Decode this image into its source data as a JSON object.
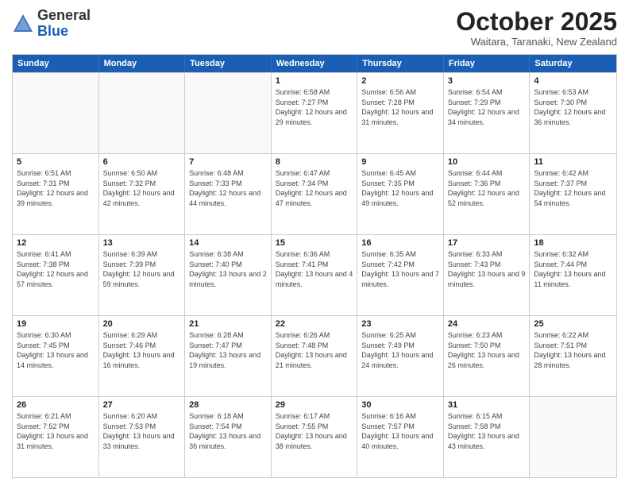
{
  "header": {
    "logo_general": "General",
    "logo_blue": "Blue",
    "month_title": "October 2025",
    "location": "Waitara, Taranaki, New Zealand"
  },
  "days_of_week": [
    "Sunday",
    "Monday",
    "Tuesday",
    "Wednesday",
    "Thursday",
    "Friday",
    "Saturday"
  ],
  "weeks": [
    [
      {
        "day": "",
        "info": ""
      },
      {
        "day": "",
        "info": ""
      },
      {
        "day": "",
        "info": ""
      },
      {
        "day": "1",
        "info": "Sunrise: 6:58 AM\nSunset: 7:27 PM\nDaylight: 12 hours and 29 minutes."
      },
      {
        "day": "2",
        "info": "Sunrise: 6:56 AM\nSunset: 7:28 PM\nDaylight: 12 hours and 31 minutes."
      },
      {
        "day": "3",
        "info": "Sunrise: 6:54 AM\nSunset: 7:29 PM\nDaylight: 12 hours and 34 minutes."
      },
      {
        "day": "4",
        "info": "Sunrise: 6:53 AM\nSunset: 7:30 PM\nDaylight: 12 hours and 36 minutes."
      }
    ],
    [
      {
        "day": "5",
        "info": "Sunrise: 6:51 AM\nSunset: 7:31 PM\nDaylight: 12 hours and 39 minutes."
      },
      {
        "day": "6",
        "info": "Sunrise: 6:50 AM\nSunset: 7:32 PM\nDaylight: 12 hours and 42 minutes."
      },
      {
        "day": "7",
        "info": "Sunrise: 6:48 AM\nSunset: 7:33 PM\nDaylight: 12 hours and 44 minutes."
      },
      {
        "day": "8",
        "info": "Sunrise: 6:47 AM\nSunset: 7:34 PM\nDaylight: 12 hours and 47 minutes."
      },
      {
        "day": "9",
        "info": "Sunrise: 6:45 AM\nSunset: 7:35 PM\nDaylight: 12 hours and 49 minutes."
      },
      {
        "day": "10",
        "info": "Sunrise: 6:44 AM\nSunset: 7:36 PM\nDaylight: 12 hours and 52 minutes."
      },
      {
        "day": "11",
        "info": "Sunrise: 6:42 AM\nSunset: 7:37 PM\nDaylight: 12 hours and 54 minutes."
      }
    ],
    [
      {
        "day": "12",
        "info": "Sunrise: 6:41 AM\nSunset: 7:38 PM\nDaylight: 12 hours and 57 minutes."
      },
      {
        "day": "13",
        "info": "Sunrise: 6:39 AM\nSunset: 7:39 PM\nDaylight: 12 hours and 59 minutes."
      },
      {
        "day": "14",
        "info": "Sunrise: 6:38 AM\nSunset: 7:40 PM\nDaylight: 13 hours and 2 minutes."
      },
      {
        "day": "15",
        "info": "Sunrise: 6:36 AM\nSunset: 7:41 PM\nDaylight: 13 hours and 4 minutes."
      },
      {
        "day": "16",
        "info": "Sunrise: 6:35 AM\nSunset: 7:42 PM\nDaylight: 13 hours and 7 minutes."
      },
      {
        "day": "17",
        "info": "Sunrise: 6:33 AM\nSunset: 7:43 PM\nDaylight: 13 hours and 9 minutes."
      },
      {
        "day": "18",
        "info": "Sunrise: 6:32 AM\nSunset: 7:44 PM\nDaylight: 13 hours and 11 minutes."
      }
    ],
    [
      {
        "day": "19",
        "info": "Sunrise: 6:30 AM\nSunset: 7:45 PM\nDaylight: 13 hours and 14 minutes."
      },
      {
        "day": "20",
        "info": "Sunrise: 6:29 AM\nSunset: 7:46 PM\nDaylight: 13 hours and 16 minutes."
      },
      {
        "day": "21",
        "info": "Sunrise: 6:28 AM\nSunset: 7:47 PM\nDaylight: 13 hours and 19 minutes."
      },
      {
        "day": "22",
        "info": "Sunrise: 6:26 AM\nSunset: 7:48 PM\nDaylight: 13 hours and 21 minutes."
      },
      {
        "day": "23",
        "info": "Sunrise: 6:25 AM\nSunset: 7:49 PM\nDaylight: 13 hours and 24 minutes."
      },
      {
        "day": "24",
        "info": "Sunrise: 6:23 AM\nSunset: 7:50 PM\nDaylight: 13 hours and 26 minutes."
      },
      {
        "day": "25",
        "info": "Sunrise: 6:22 AM\nSunset: 7:51 PM\nDaylight: 13 hours and 28 minutes."
      }
    ],
    [
      {
        "day": "26",
        "info": "Sunrise: 6:21 AM\nSunset: 7:52 PM\nDaylight: 13 hours and 31 minutes."
      },
      {
        "day": "27",
        "info": "Sunrise: 6:20 AM\nSunset: 7:53 PM\nDaylight: 13 hours and 33 minutes."
      },
      {
        "day": "28",
        "info": "Sunrise: 6:18 AM\nSunset: 7:54 PM\nDaylight: 13 hours and 36 minutes."
      },
      {
        "day": "29",
        "info": "Sunrise: 6:17 AM\nSunset: 7:55 PM\nDaylight: 13 hours and 38 minutes."
      },
      {
        "day": "30",
        "info": "Sunrise: 6:16 AM\nSunset: 7:57 PM\nDaylight: 13 hours and 40 minutes."
      },
      {
        "day": "31",
        "info": "Sunrise: 6:15 AM\nSunset: 7:58 PM\nDaylight: 13 hours and 43 minutes."
      },
      {
        "day": "",
        "info": ""
      }
    ]
  ]
}
